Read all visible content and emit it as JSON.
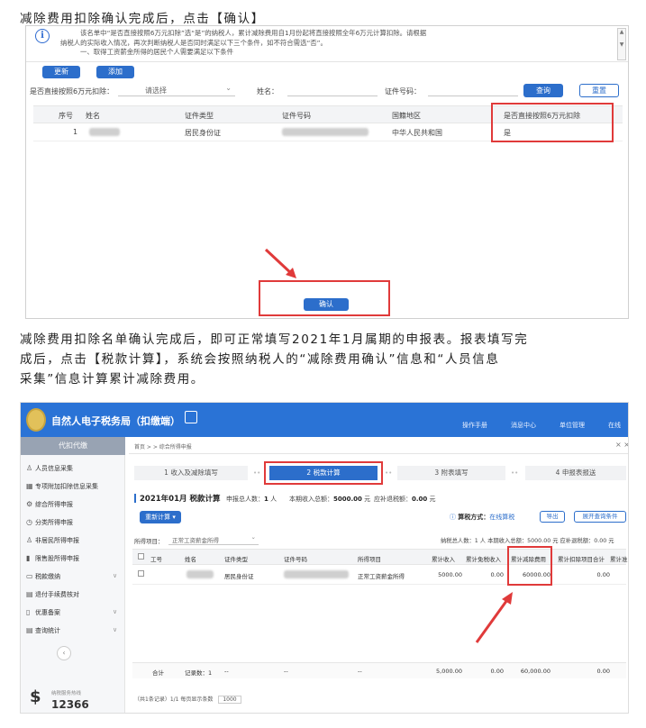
{
  "p1": "减除费用扣除确认完成后，点击【确认】",
  "shot1": {
    "notice_lines": [
      "该名单中“是否直接按照6万元扣除”选“是”的纳税人，累计减除费用自1月份起将直接按照全年6万元计算扣除。请根据",
      "纳税人的实际收入情况，再次判断纳税人是否同时满足以下三个条件，如不符合需选“否”。",
      "一、取得工资薪金所得的居民个人需要满足以下条件"
    ],
    "btn_update": "更新",
    "btn_add": "添加",
    "filter_label": "是否直接按照6万元扣除：",
    "filter_value": "请选择",
    "name_label": "姓名：",
    "idno_label": "证件号码：",
    "btn_query": "查询",
    "btn_reset": "重置",
    "columns": [
      "序号",
      "姓名",
      "证件类型",
      "证件号码",
      "国籍地区",
      "是否直接按照6万元扣除"
    ],
    "row": {
      "index": "1",
      "id_type": "居民身份证",
      "country": "中华人民共和国",
      "direct": "是"
    },
    "btn_confirm": "确认"
  },
  "p2": [
    "减除费用扣除名单确认完成后，即可正常填写2021年1月属期的申报表。报表填写完",
    "成后，点击【税款计算】，系统会按照纳税人的“减除费用确认”信息和“人员信息",
    "采集”信息计算累计减除费用。"
  ],
  "shot2": {
    "app_title": "自然人电子税务局（扣缴端）",
    "company": "代扣代缴",
    "top_icons": [
      "操作手册",
      "消息中心",
      "单位管理",
      "在线"
    ],
    "side_header": "代扣代缴",
    "side_items": [
      "人员信息采集",
      "专项附加扣除信息采集",
      "综合所得申报",
      "分类所得申报",
      "非居民所得申报",
      "限售股所得申报",
      "税款缴纳",
      "退付手续费核对",
      "优惠备案",
      "查询统计"
    ],
    "hotline": "12366",
    "hotline_caption": "纳税服务热线",
    "breadcrumb": "首页 > > 综合所得申报",
    "steps": [
      "1 收入及减除填写",
      "2 税款计算",
      "3 附表填写",
      "4 申报表报送"
    ],
    "period_title": "2021年01月 税款计算",
    "count_label": "申报总人数：",
    "count_value": "1",
    "count_unit": "人",
    "income_label": "本期收入总额：",
    "income_value": "5000.00",
    "income_unit": "元",
    "tax_label": "应补退税额：",
    "tax_value": "0.00",
    "tax_unit": "元",
    "btn_recalc": "重新计算",
    "calc_mode_label": "算税方式：",
    "calc_mode_value": "在线算税",
    "btn_export": "导出",
    "btn_expand": "展开查询条件",
    "income_item_label": "所得项目：",
    "income_item_value": "正常工资薪金所得",
    "summary_line": "纳税总人数：1 人  本期收入总额：5000.00 元  应补退税额：0.00 元",
    "columns": [
      "工号",
      "姓名",
      "证件类型",
      "证件号码",
      "所得项目",
      "累计收入",
      "累计免税收入",
      "累计减除费用",
      "累计扣除项目合计",
      "累计准"
    ],
    "row": {
      "id_type": "居民身份证",
      "item": "正常工资薪金所得",
      "income": "5000.00",
      "tax_free": "0.00",
      "deduct": "60000.00",
      "deduct_total": "0.00"
    },
    "total_label": "合计",
    "record_label": "记录数：1",
    "total_dash": "--",
    "total_income": "5,000.00",
    "total_tax_free": "0.00",
    "total_deduct": "60,000.00",
    "total_deduct_total": "0.00",
    "pager": "（共1条记录）1/1  每页显示条数",
    "pager_size": "1000"
  }
}
